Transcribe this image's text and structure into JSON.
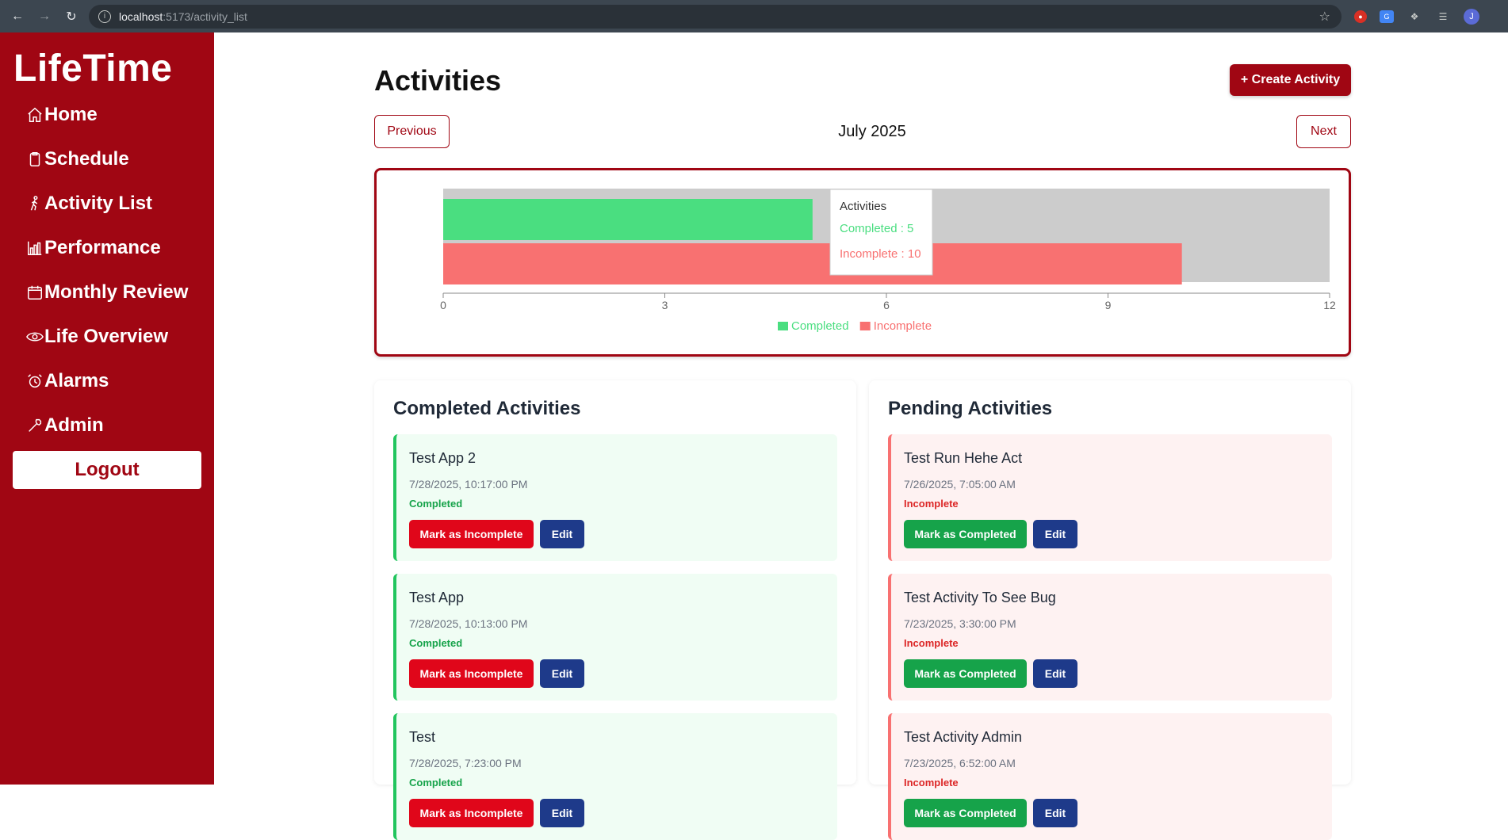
{
  "browser": {
    "url_host": "localhost",
    "url_path": ":5173/activity_list",
    "avatar_letter": "J"
  },
  "sidebar": {
    "logo": "LifeTime",
    "items": [
      {
        "label": "Home",
        "icon": "home-icon"
      },
      {
        "label": "Schedule",
        "icon": "clipboard-icon"
      },
      {
        "label": "Activity List",
        "icon": "walking-icon"
      },
      {
        "label": "Performance",
        "icon": "bar-chart-icon"
      },
      {
        "label": "Monthly Review",
        "icon": "calendar-icon"
      },
      {
        "label": "Life Overview",
        "icon": "eye-icon"
      },
      {
        "label": "Alarms",
        "icon": "alarm-icon"
      },
      {
        "label": "Admin",
        "icon": "wrench-icon"
      }
    ],
    "logout": "Logout"
  },
  "main": {
    "title": "Activities",
    "create_button": "+ Create Activity",
    "previous": "Previous",
    "next": "Next",
    "month": "July 2025"
  },
  "chart_data": {
    "type": "bar",
    "orientation": "horizontal",
    "categories": [
      "Activities"
    ],
    "series": [
      {
        "name": "Completed",
        "values": [
          5
        ],
        "color": "#4ade80"
      },
      {
        "name": "Incomplete",
        "values": [
          10
        ],
        "color": "#f87171"
      }
    ],
    "xlim": [
      0,
      12
    ],
    "xticks": [
      "0",
      "3",
      "6",
      "9",
      "12"
    ],
    "legend": "bottom",
    "tooltip": {
      "title": "Activities",
      "lines": [
        "Completed : 5",
        "Incomplete : 10"
      ]
    }
  },
  "completed": {
    "heading": "Completed Activities",
    "items": [
      {
        "title": "Test App 2",
        "date": "7/28/2025, 10:17:00 PM",
        "status": "Completed",
        "action": "Mark as Incomplete",
        "edit": "Edit"
      },
      {
        "title": "Test App",
        "date": "7/28/2025, 10:13:00 PM",
        "status": "Completed",
        "action": "Mark as Incomplete",
        "edit": "Edit"
      },
      {
        "title": "Test",
        "date": "7/28/2025, 7:23:00 PM",
        "status": "Completed",
        "action": "Mark as Incomplete",
        "edit": "Edit"
      }
    ]
  },
  "pending": {
    "heading": "Pending Activities",
    "items": [
      {
        "title": "Test Run Hehe Act",
        "date": "7/26/2025, 7:05:00 AM",
        "status": "Incomplete",
        "action": "Mark as Completed",
        "edit": "Edit"
      },
      {
        "title": "Test Activity To See Bug",
        "date": "7/23/2025, 3:30:00 PM",
        "status": "Incomplete",
        "action": "Mark as Completed",
        "edit": "Edit"
      },
      {
        "title": "Test Activity Admin",
        "date": "7/23/2025, 6:52:00 AM",
        "status": "Incomplete",
        "action": "Mark as Completed",
        "edit": "Edit"
      }
    ]
  }
}
